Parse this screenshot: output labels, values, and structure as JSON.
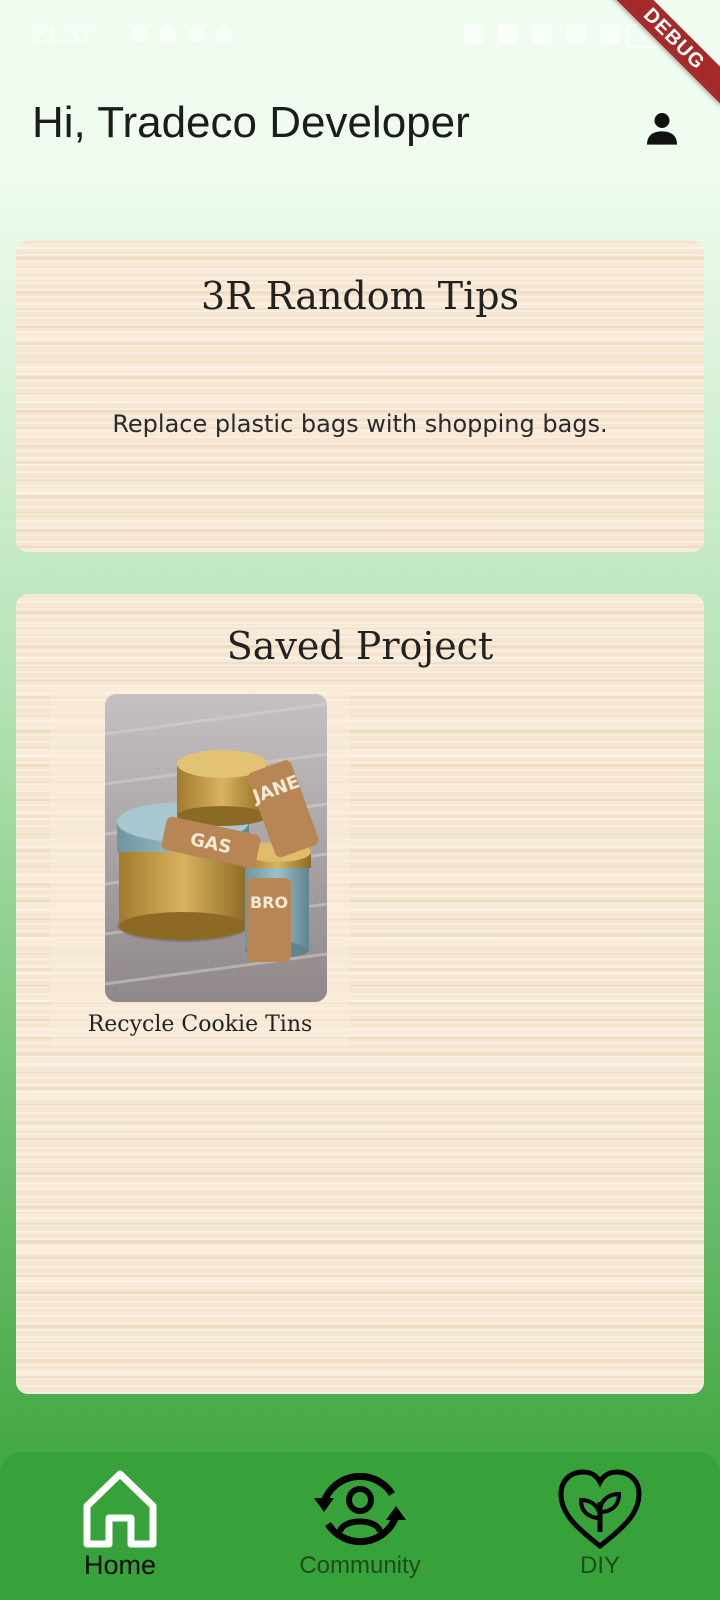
{
  "status_bar": {
    "time": "21:37",
    "battery": "55"
  },
  "debug_banner": "DEBUG",
  "header": {
    "greeting": "Hi, Tradeco Developer",
    "profile_icon": "person-icon"
  },
  "tips_card": {
    "title": "3R Random Tips",
    "tip": "Replace plastic bags with shopping bags."
  },
  "saved_card": {
    "title": "Saved Project",
    "projects": [
      {
        "caption": "Recycle Cookie Tins",
        "tag_labels": [
          "JANE",
          "GAS",
          "BRO"
        ]
      }
    ]
  },
  "bottom_nav": {
    "items": [
      {
        "label": "Home",
        "icon": "home-icon",
        "active": true
      },
      {
        "label": "Community",
        "icon": "community-icon",
        "active": false
      },
      {
        "label": "DIY",
        "icon": "diy-heart-icon",
        "active": false
      }
    ]
  },
  "colors": {
    "nav_background": "#37a13a",
    "card_background": "#f6e6d1",
    "debug_ribbon": "#a52a2a"
  }
}
